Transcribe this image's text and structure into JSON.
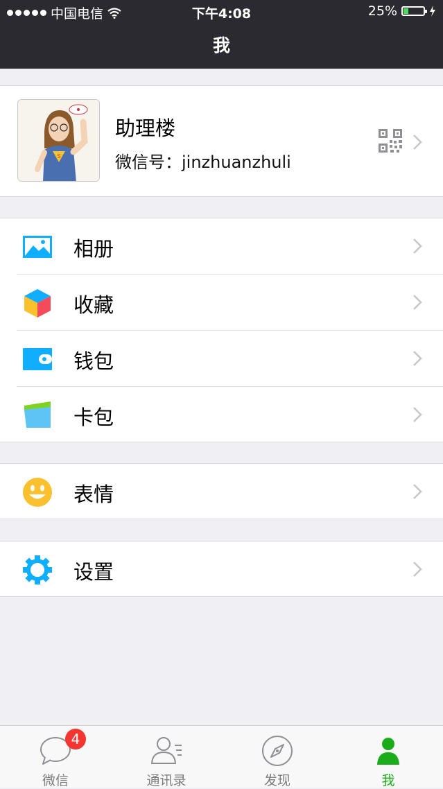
{
  "status_bar": {
    "carrier": "中国电信",
    "time": "下午4:08",
    "battery_percent": "25%",
    "battery_level": 0.25
  },
  "nav": {
    "title": "我"
  },
  "profile": {
    "name": "助理楼",
    "wechat_id": "微信号：jinzhuanzhuli"
  },
  "menu": {
    "group1": [
      {
        "label": "相册",
        "icon": "album-icon"
      },
      {
        "label": "收藏",
        "icon": "favorites-icon"
      },
      {
        "label": "钱包",
        "icon": "wallet-icon"
      },
      {
        "label": "卡包",
        "icon": "card-wallet-icon"
      }
    ],
    "group2": [
      {
        "label": "表情",
        "icon": "sticker-icon"
      }
    ],
    "group3": [
      {
        "label": "设置",
        "icon": "settings-icon"
      }
    ]
  },
  "tabbar": {
    "tabs": [
      {
        "label": "微信",
        "icon": "chat-icon",
        "badge": "4"
      },
      {
        "label": "通讯录",
        "icon": "contacts-icon"
      },
      {
        "label": "发现",
        "icon": "compass-icon"
      },
      {
        "label": "我",
        "icon": "me-icon",
        "active": true
      }
    ]
  },
  "colors": {
    "accent": "#1aad19",
    "nav_bg": "#2b2a30",
    "badge": "#f43530",
    "icon_blue": "#10aeff"
  }
}
